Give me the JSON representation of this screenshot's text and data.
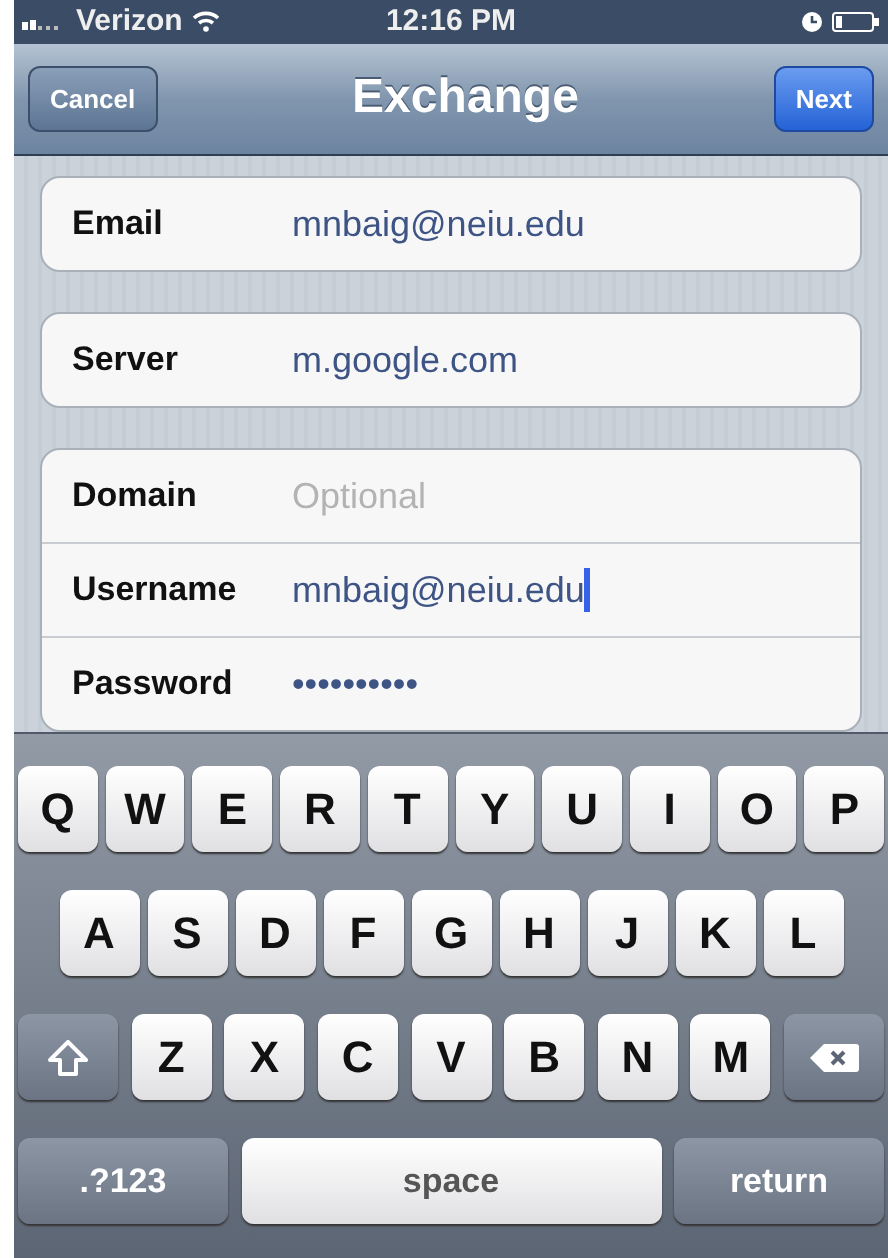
{
  "status_bar": {
    "carrier": "Verizon",
    "time": "12:16 PM"
  },
  "nav": {
    "title": "Exchange",
    "left_button": "Cancel",
    "right_button": "Next"
  },
  "groups": [
    {
      "fields": [
        {
          "label": "Email",
          "value": "mnbaig@neiu.edu",
          "focused": false
        }
      ]
    },
    {
      "fields": [
        {
          "label": "Server",
          "value": "m.google.com",
          "focused": false
        }
      ]
    },
    {
      "fields": [
        {
          "label": "Domain",
          "placeholder": "Optional",
          "focused": false
        },
        {
          "label": "Username",
          "value": "mnbaig@neiu.edu",
          "focused": true
        },
        {
          "label": "Password",
          "value": "••••••••••",
          "focused": false
        }
      ]
    }
  ],
  "keyboard": {
    "rows": [
      [
        {
          "kind": "letter",
          "label": "Q"
        },
        {
          "kind": "letter",
          "label": "W"
        },
        {
          "kind": "letter",
          "label": "E"
        },
        {
          "kind": "letter",
          "label": "R"
        },
        {
          "kind": "letter",
          "label": "T"
        },
        {
          "kind": "letter",
          "label": "Y"
        },
        {
          "kind": "letter",
          "label": "U"
        },
        {
          "kind": "letter",
          "label": "I"
        },
        {
          "kind": "letter",
          "label": "O"
        },
        {
          "kind": "letter",
          "label": "P"
        }
      ],
      [
        {
          "kind": "letter",
          "label": "A"
        },
        {
          "kind": "letter",
          "label": "S"
        },
        {
          "kind": "letter",
          "label": "D"
        },
        {
          "kind": "letter",
          "label": "F"
        },
        {
          "kind": "letter",
          "label": "G"
        },
        {
          "kind": "letter",
          "label": "H"
        },
        {
          "kind": "letter",
          "label": "J"
        },
        {
          "kind": "letter",
          "label": "K"
        },
        {
          "kind": "letter",
          "label": "L"
        }
      ],
      [
        {
          "kind": "shift"
        },
        {
          "kind": "letter",
          "label": "Z"
        },
        {
          "kind": "letter",
          "label": "X"
        },
        {
          "kind": "letter",
          "label": "C"
        },
        {
          "kind": "letter",
          "label": "V"
        },
        {
          "kind": "letter",
          "label": "B"
        },
        {
          "kind": "letter",
          "label": "N"
        },
        {
          "kind": "letter",
          "label": "M"
        },
        {
          "kind": "delete"
        }
      ]
    ],
    "bottom_row": [
      {
        "kind": "mode",
        "label": ".?123"
      },
      {
        "kind": "space",
        "label": "space"
      },
      {
        "kind": "return",
        "label": "return"
      }
    ]
  }
}
